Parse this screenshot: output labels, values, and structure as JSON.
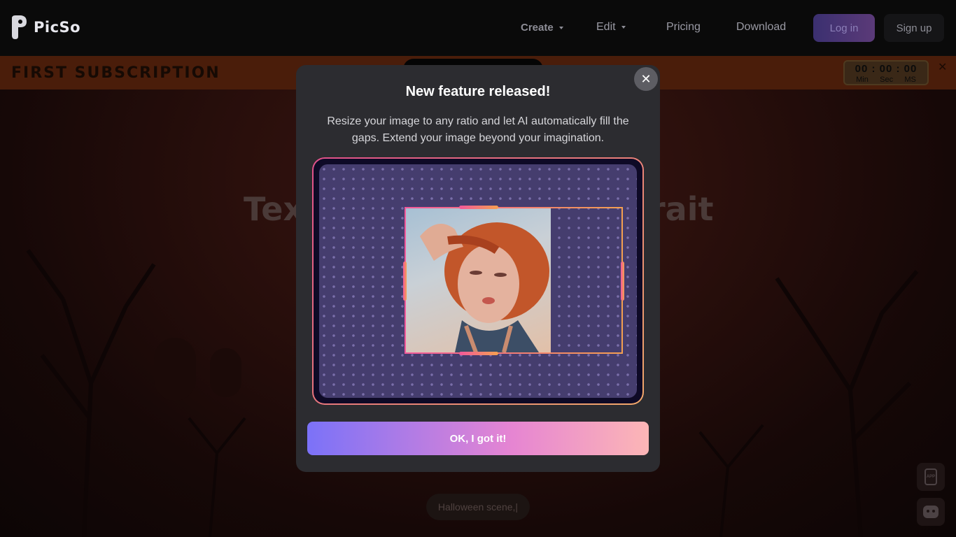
{
  "nav": {
    "brand": "PicSo",
    "create": "Create",
    "edit": "Edit",
    "pricing": "Pricing",
    "download": "Download",
    "login": "Log in",
    "signup": "Sign up"
  },
  "promo": {
    "text": "FIRST SUBSCRIPTION",
    "timer": "00 : 00 : 00",
    "labels": [
      "Min",
      "Sec",
      "MS"
    ],
    "close": "✕"
  },
  "hero": {
    "title_left": "Tex",
    "title_right": "rait",
    "prompt": "Halloween scene,|",
    "app_badge": "APP"
  },
  "modal": {
    "close": "✕",
    "title": "New feature released!",
    "description": "Resize your image to any ratio and let AI automatically fill the gaps. Extend your image beyond your imagination.",
    "ok": "OK, I got it!"
  }
}
